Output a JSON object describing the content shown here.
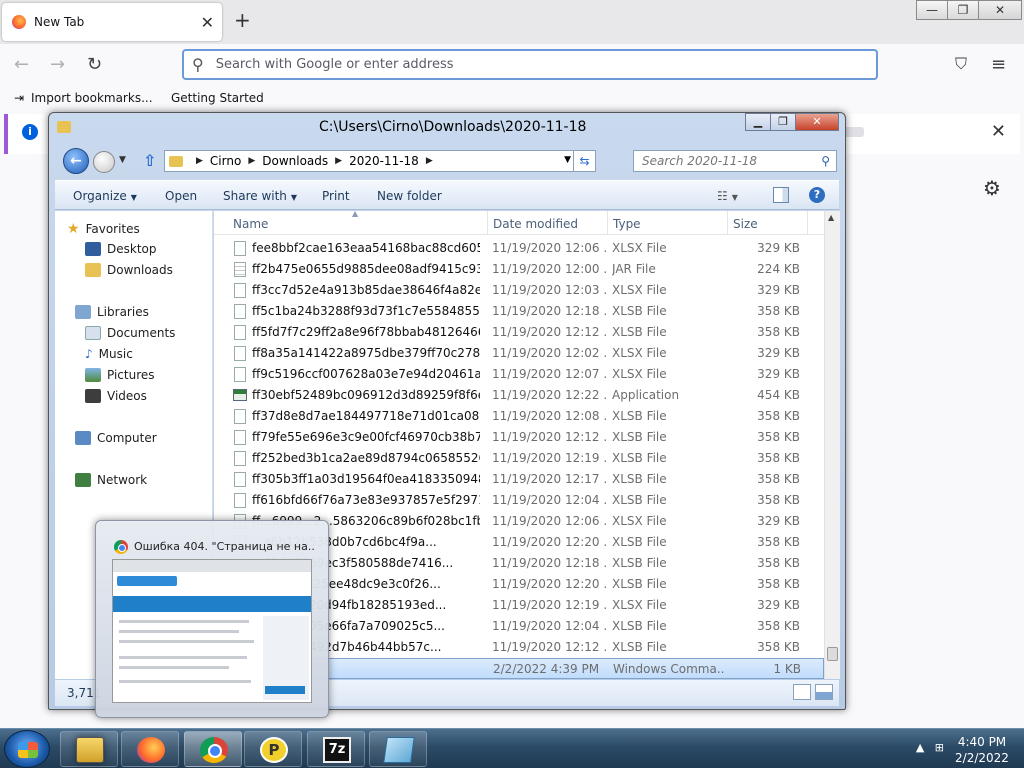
{
  "firefox": {
    "tab_title": "New Tab",
    "tab_close": "✕",
    "new_tab": "+",
    "window_buttons": {
      "minimize": "—",
      "restore": "❐",
      "close": "✕"
    },
    "nav": {
      "back": "←",
      "forward": "→",
      "reload": "↻"
    },
    "search_placeholder": "Search with Google or enter address",
    "bookmarks": [
      "Import bookmarks...",
      "Getting Started"
    ],
    "infobar_close": "✕"
  },
  "explorer": {
    "title": "C:\\Users\\Cirno\\Downloads\\2020-11-18",
    "window_buttons": {
      "minimize": "▁",
      "restore": "❐",
      "close": "✕"
    },
    "breadcrumb": [
      "Cirno",
      "Downloads",
      "2020-11-18"
    ],
    "search_placeholder": "Search 2020-11-18",
    "commands": {
      "organize": "Organize",
      "open": "Open",
      "share_with": "Share with",
      "print": "Print",
      "new_folder": "New folder"
    },
    "nav_tree": {
      "favorites": "Favorites",
      "desktop": "Desktop",
      "downloads": "Downloads",
      "libraries": "Libraries",
      "documents": "Documents",
      "music": "Music",
      "pictures": "Pictures",
      "videos": "Videos",
      "computer": "Computer",
      "network": "Network"
    },
    "columns": {
      "name": "Name",
      "date": "Date modified",
      "type": "Type",
      "size": "Size"
    },
    "files": [
      {
        "name": "fee8bbf2cae163eaa54168bac88cd60551e3...",
        "date": "11/19/2020 12:06 ...",
        "type": "XLSX File",
        "size": "329 KB",
        "icon": "doc"
      },
      {
        "name": "ff2b475e0655d9885dee08adf9415c93751f...",
        "date": "11/19/2020 12:00 ...",
        "type": "JAR File",
        "size": "224 KB",
        "icon": "jar"
      },
      {
        "name": "ff3cc7d52e4a913b85dae38646f4a82e765c...",
        "date": "11/19/2020 12:03 ...",
        "type": "XLSX File",
        "size": "329 KB",
        "icon": "doc"
      },
      {
        "name": "ff5c1ba24b3288f93d73f1c7e5584855526ec...",
        "date": "11/19/2020 12:18 ...",
        "type": "XLSB File",
        "size": "358 KB",
        "icon": "doc"
      },
      {
        "name": "ff5fd7f7c29ff2a8e96f78bbab48126466bb9...",
        "date": "11/19/2020 12:12 ...",
        "type": "XLSB File",
        "size": "358 KB",
        "icon": "doc"
      },
      {
        "name": "ff8a35a141422a8975dbe379ff70c27872028...",
        "date": "11/19/2020 12:02 ...",
        "type": "XLSX File",
        "size": "329 KB",
        "icon": "doc"
      },
      {
        "name": "ff9c5196ccf007628a03e7e94d20461a7de7...",
        "date": "11/19/2020 12:07 ...",
        "type": "XLSX File",
        "size": "329 KB",
        "icon": "doc"
      },
      {
        "name": "ff30ebf52489bc096912d3d89259f8f6e44ec...",
        "date": "11/19/2020 12:22 ...",
        "type": "Application",
        "size": "454 KB",
        "icon": "app"
      },
      {
        "name": "ff37d8e8d7ae184497718e71d01ca0824bdc...",
        "date": "11/19/2020 12:08 ...",
        "type": "XLSB File",
        "size": "358 KB",
        "icon": "doc"
      },
      {
        "name": "ff79fe55e696e3c9e00fcf46970cb38b71215...",
        "date": "11/19/2020 12:12 ...",
        "type": "XLSB File",
        "size": "358 KB",
        "icon": "doc"
      },
      {
        "name": "ff252bed3b1ca2ae89d8794c06585526889a...",
        "date": "11/19/2020 12:19 ...",
        "type": "XLSB File",
        "size": "358 KB",
        "icon": "doc"
      },
      {
        "name": "ff305b3ff1a03d19564f0ea418335094853b4...",
        "date": "11/19/2020 12:17 ...",
        "type": "XLSB File",
        "size": "358 KB",
        "icon": "doc"
      },
      {
        "name": "ff616bfd66f76a73e83e937857e5f29716d6b...",
        "date": "11/19/2020 12:04 ...",
        "type": "XLSB File",
        "size": "358 KB",
        "icon": "doc"
      },
      {
        "name": "ff...6999...2...5863206c89b6f028bc1fb5076aa...",
        "date": "11/19/2020 12:06 ...",
        "type": "XLSX File",
        "size": "329 KB",
        "icon": "doc"
      },
      {
        "name": "...a6b12b538d0b7cd6bc4f9a...",
        "date": "11/19/2020 12:20 ...",
        "type": "XLSB File",
        "size": "358 KB",
        "icon": "doc"
      },
      {
        "name": "...52497369ec3f580588de7416...",
        "date": "11/19/2020 12:18 ...",
        "type": "XLSB File",
        "size": "358 KB",
        "icon": "doc"
      },
      {
        "name": "...6f9d26325ee48dc9e3c0f26...",
        "date": "11/19/2020 12:20 ...",
        "type": "XLSB File",
        "size": "358 KB",
        "icon": "doc"
      },
      {
        "name": "...151ee220d94fb18285193ed...",
        "date": "11/19/2020 12:19 ...",
        "type": "XLSX File",
        "size": "329 KB",
        "icon": "doc"
      },
      {
        "name": "...4a5d6205e66fa7a709025c5...",
        "date": "11/19/2020 12:04 ...",
        "type": "XLSB File",
        "size": "358 KB",
        "icon": "doc"
      },
      {
        "name": "...9e9b22492d7b46b44bb57c...",
        "date": "11/19/2020 12:12 ...",
        "type": "XLSB File",
        "size": "358 KB",
        "icon": "doc"
      },
      {
        "name": "",
        "date": "2/2/2022 4:39 PM",
        "type": "Windows Comma...",
        "size": "1 KB",
        "icon": "none",
        "selected": true
      }
    ],
    "item_count": "3,711"
  },
  "preview": {
    "title": "Ошибка 404. \"Страница не на..."
  },
  "taskbar": {
    "apps": [
      "Windows Explorer",
      "Firefox",
      "Google Chrome",
      "PDF Reader",
      "7-Zip",
      "Notepad"
    ],
    "pdf_glyph": "P",
    "sevenz_glyph": "7z",
    "time": "4:40 PM",
    "date": "2/2/2022"
  }
}
